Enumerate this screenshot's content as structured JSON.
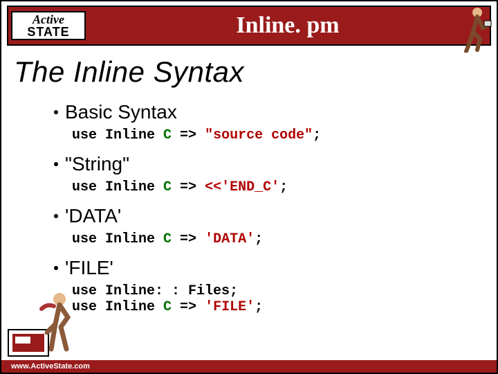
{
  "title": "Inline. pm",
  "logo": {
    "line1": "Active",
    "line2": "STATE"
  },
  "heading": "The Inline Syntax",
  "footer_url": "www.ActiveState.com",
  "bullets": [
    {
      "label": "Basic Syntax",
      "code_html": "<span class='kw'>use Inline </span><span class='lang'>C</span><span class='arrow'> =&gt; </span><span class='str'>\"source code\"</span>;"
    },
    {
      "label": "\"String\"",
      "code_html": "<span class='kw'>use Inline </span><span class='lang'>C</span><span class='arrow'> =&gt; </span><span class='str'>&lt;&lt;'END_C'</span>;"
    },
    {
      "label": "'DATA'",
      "code_html": "<span class='kw'>use Inline </span><span class='lang'>C</span><span class='arrow'> =&gt; </span><span class='str'>'DATA'</span>;"
    },
    {
      "label": "'FILE'",
      "code_html": "<span class='mod'>use Inline: : Files;</span>\n<span class='kw'>use Inline </span><span class='lang'>C</span><span class='arrow'> =&gt; </span><span class='str'>'FILE'</span>;"
    }
  ]
}
